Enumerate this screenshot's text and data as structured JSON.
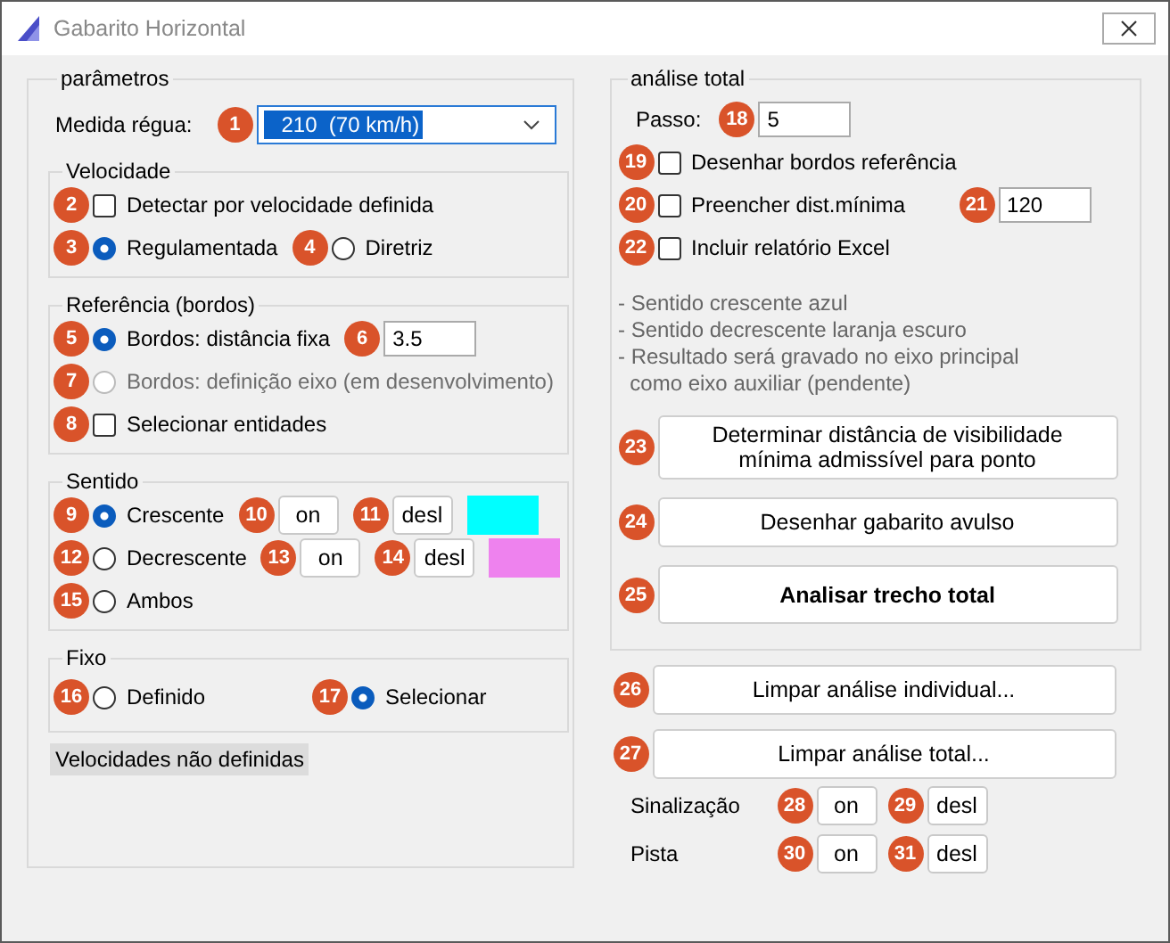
{
  "window": {
    "title": "Gabarito Horizontal"
  },
  "parametros": {
    "legend": "parâmetros",
    "medida": {
      "badge": "1",
      "label": "Medida régua:",
      "value": "210  (70 km/h)"
    },
    "groups": [
      {
        "legend": "Velocidade",
        "rows": [
          [
            {
              "kind": "checkbox",
              "badge": "2",
              "label": "Detectar por velocidade definida",
              "checked": false,
              "disabled": false
            }
          ],
          [
            {
              "kind": "radio",
              "badge": "3",
              "label": "Regulamentada",
              "selected": true,
              "disabled": false
            },
            {
              "kind": "radio",
              "badge": "4",
              "label": "Diretriz",
              "selected": false,
              "disabled": false
            }
          ]
        ]
      },
      {
        "legend": "Referência (bordos)",
        "rows": [
          [
            {
              "kind": "radio",
              "badge": "5",
              "label": "Bordos: distância fixa",
              "selected": true,
              "disabled": false
            },
            {
              "kind": "field",
              "badge": "6",
              "value": "3.5"
            }
          ],
          [
            {
              "kind": "radio",
              "badge": "7",
              "label": "Bordos: definição eixo (em desenvolvimento)",
              "selected": false,
              "disabled": true
            }
          ],
          [
            {
              "kind": "checkbox",
              "badge": "8",
              "label": "Selecionar entidades",
              "checked": false,
              "disabled": false
            }
          ]
        ]
      },
      {
        "legend": "Sentido",
        "rows": [
          [
            {
              "kind": "radio",
              "badge": "9",
              "label": "Crescente",
              "selected": true,
              "disabled": false
            },
            {
              "kind": "button",
              "badge": "10",
              "label": "on"
            },
            {
              "kind": "button",
              "badge": "11",
              "label": "desl"
            },
            {
              "kind": "swatch",
              "color": "#00ffff"
            }
          ],
          [
            {
              "kind": "radio",
              "badge": "12",
              "label": "Decrescente",
              "selected": false,
              "disabled": false
            },
            {
              "kind": "button",
              "badge": "13",
              "label": "on"
            },
            {
              "kind": "button",
              "badge": "14",
              "label": "desl"
            },
            {
              "kind": "swatch",
              "color": "#ee82ee"
            }
          ],
          [
            {
              "kind": "radio",
              "badge": "15",
              "label": "Ambos",
              "selected": false,
              "disabled": false
            }
          ]
        ]
      },
      {
        "legend": "Fixo",
        "rows": [
          [
            {
              "kind": "radio",
              "badge": "16",
              "label": "Definido",
              "selected": false,
              "disabled": false
            },
            {
              "kind": "radio",
              "badge": "17",
              "label": "Selecionar",
              "selected": true,
              "disabled": false
            }
          ]
        ]
      }
    ],
    "status": "Velocidades não definidas"
  },
  "analise": {
    "legend": "análise total",
    "passo": {
      "label": "Passo:",
      "badge": "18",
      "value": "5"
    },
    "rows": [
      [
        {
          "kind": "checkbox",
          "badge": "19",
          "label": "Desenhar bordos referência",
          "checked": false,
          "disabled": false
        }
      ],
      [
        {
          "kind": "checkbox",
          "badge": "20",
          "label": "Preencher dist.mínima",
          "checked": false,
          "disabled": false
        },
        {
          "kind": "field",
          "badge": "21",
          "value": "120"
        }
      ],
      [
        {
          "kind": "checkbox",
          "badge": "22",
          "label": "Incluir relatório Excel",
          "checked": false,
          "disabled": false
        }
      ]
    ],
    "notes": [
      "- Sentido crescente azul",
      "- Sentido decrescente laranja escuro",
      "- Resultado será gravado no eixo principal\n  como eixo auxiliar (pendente)"
    ],
    "buttons": [
      {
        "badge": "23",
        "label": "Determinar distância de visibilidade\nmínima admissível para ponto",
        "bold": false
      },
      {
        "badge": "24",
        "label": "Desenhar gabarito avulso",
        "bold": false
      },
      {
        "badge": "25",
        "label": "Analisar trecho total",
        "bold": true
      }
    ]
  },
  "buttons": [
    {
      "badge": "26",
      "label": "Limpar análise individual..."
    },
    {
      "badge": "27",
      "label": "Limpar análise total..."
    }
  ],
  "toggles": [
    [
      {
        "kind": "text",
        "label": "Sinalização"
      },
      {
        "kind": "button",
        "badge": "28",
        "label": "on"
      },
      {
        "kind": "button",
        "badge": "29",
        "label": "desl"
      }
    ],
    [
      {
        "kind": "text",
        "label": "Pista"
      },
      {
        "kind": "button",
        "badge": "30",
        "label": "on"
      },
      {
        "kind": "button",
        "badge": "31",
        "label": "desl"
      }
    ]
  ]
}
